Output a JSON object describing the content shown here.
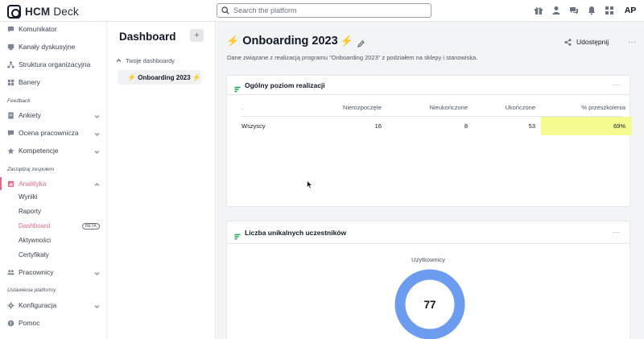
{
  "app": {
    "brand_strong": "HCM",
    "brand_light": "Deck",
    "search_placeholder": "Search the platform",
    "user_initials": "AP",
    "top_icons": [
      "gift-icon",
      "user-icon",
      "chat-icon",
      "bell-icon",
      "grid-icon"
    ]
  },
  "sidebar": {
    "items_top": [
      {
        "label": "Komunikator",
        "icon": "chat-icon"
      },
      {
        "label": "Kanały dyskusyjne",
        "icon": "channel-icon"
      },
      {
        "label": "Struktura organizacyjna",
        "icon": "org-icon"
      },
      {
        "label": "Banery",
        "icon": "banner-icon"
      }
    ],
    "section_feedback": "Feedback",
    "items_feedback": [
      {
        "label": "Ankiety",
        "icon": "survey-icon"
      },
      {
        "label": "Ocena pracownicza",
        "icon": "evaluation-icon"
      },
      {
        "label": "Kompetencje",
        "icon": "star-icon"
      }
    ],
    "section_team": "Zarządzaj zespołem",
    "analytics": {
      "label": "Analityka",
      "icon": "analytics-icon"
    },
    "analytics_sub": [
      "Wyniki",
      "Raporty",
      "Dashboard",
      "Aktywności",
      "Certyfikaty"
    ],
    "beta_badge": "BETA",
    "employees": {
      "label": "Pracownicy",
      "icon": "people-icon"
    },
    "section_platform": "Ustawienia platformy",
    "config": {
      "label": "Konfiguracja",
      "icon": "gear-icon"
    },
    "help": {
      "label": "Pomoc",
      "icon": "help-icon"
    }
  },
  "dashboards": {
    "title": "Dashboard",
    "add_label": "+",
    "group": "Twoje dashboardy",
    "item": "Onboarding 2023"
  },
  "main": {
    "title": "Onboarding 2023",
    "share_label": "Udostępnij",
    "more": "···",
    "subtitle": "Dane związane z realizacją programu \"Onboarding 2023\" z podziałem na sklepy i stanowiska.",
    "card1": {
      "title": "Ogólny poziom realizacji",
      "more": "···",
      "headers": [
        ".",
        "Nierozpoczęte",
        "Nieukończone",
        "Ukończone",
        "% przeszkolenia"
      ],
      "row": [
        "Wszyscy",
        "16",
        "8",
        "53",
        "69%"
      ]
    },
    "card2": {
      "title": "Liczba unikalnych uczestników",
      "more": "···",
      "chart_label": "Użytkownicy",
      "value": "77"
    }
  },
  "colors": {
    "accent": "#e06a86",
    "highlight": "#f5fb8f",
    "donut": "#6b9cf0",
    "bolt": "#f0b400"
  },
  "chart_data": {
    "type": "pie",
    "title": "Liczba unikalnych uczestników",
    "categories": [
      "Użytkownicy"
    ],
    "values": [
      77
    ],
    "legend": "none"
  }
}
